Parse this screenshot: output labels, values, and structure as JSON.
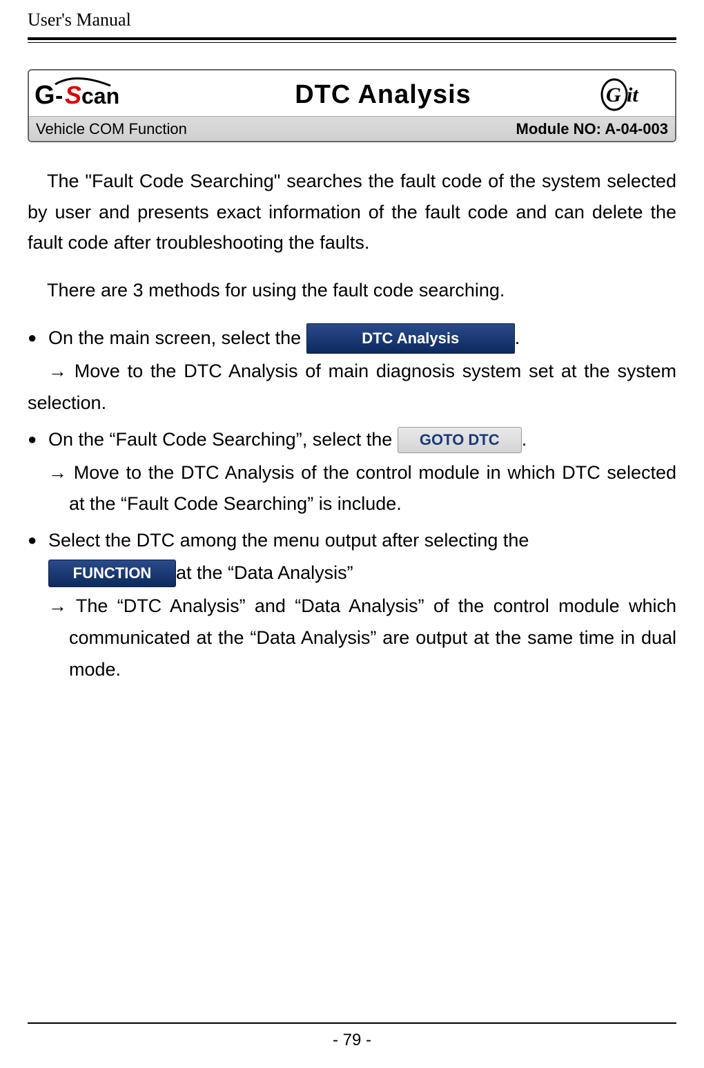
{
  "header": {
    "running": "User's Manual"
  },
  "panel": {
    "title": "DTC Analysis",
    "subtitle_left": "Vehicle COM Function",
    "subtitle_right": "Module NO: A-04-003",
    "logo_left_primary": "G-",
    "logo_left_secondary": "scan",
    "logo_right": "Git"
  },
  "buttons": {
    "dtc_analysis": "DTC Analysis",
    "goto_dtc": "GOTO DTC",
    "function": "FUNCTION"
  },
  "paragraphs": {
    "p1": "The \"Fault Code Searching\" searches the fault code of the system selected by user and presents exact information of the fault code and can delete the fault code after troubleshooting the faults.",
    "p2": "There are 3 methods for using the fault code searching."
  },
  "bullets": {
    "b1_pre": "On the main screen, select the ",
    "b1_post": ".",
    "b1_arrow": "→ Move to the DTC Analysis of main diagnosis system set at the system selection.",
    "b2_pre": "On the “Fault Code Searching”, select the ",
    "b2_post": ".",
    "b2_arrow_a": "→ Move to the DTC Analysis of the control module in which DTC selected at the “Fault Code Searching” is include.",
    "b3_pre": "Select the DTC among the menu output after selecting the ",
    "b3_post": " at the “Data Analysis”",
    "b3_arrow_a": "→ The “DTC Analysis” and “Data Analysis” of the control module which communicated at the “Data Analysis” are output at the same time in dual mode."
  },
  "footer": {
    "page": "- 79 -"
  }
}
